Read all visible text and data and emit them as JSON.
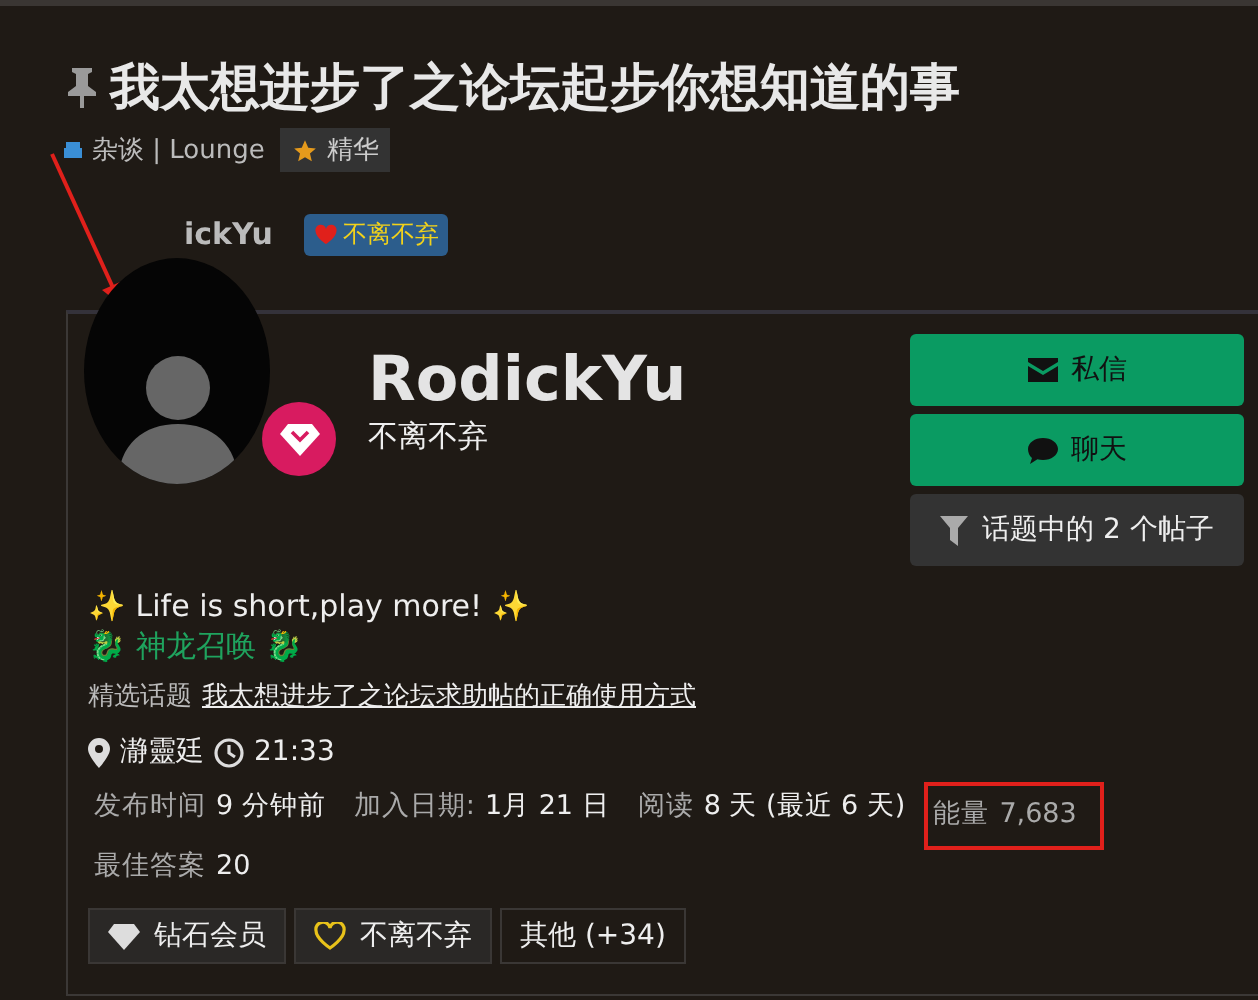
{
  "topic": {
    "title": "我太想进步了之论坛起步你想知道的事",
    "category": "杂谈 | Lounge",
    "tag": "精华"
  },
  "poster": {
    "name": "ickYu",
    "badge": "不离不弃"
  },
  "user_card": {
    "name": "RodickYu",
    "title": "不离不弃",
    "actions": [
      {
        "kind": "mail",
        "label": "私信"
      },
      {
        "kind": "chat",
        "label": "聊天"
      },
      {
        "kind": "filter",
        "label": "话题中的 2 个帖子"
      }
    ],
    "bio": [
      "✨ Life is short,play more! ✨",
      "🐉 神龙召唤 🐉"
    ],
    "featured": {
      "label": "精选话题",
      "link": "我太想进步了之论坛求助帖的正确使用方式"
    },
    "location": "瀞靈廷",
    "local_time": "21:33",
    "stats": [
      {
        "label": "发布时间",
        "value": "9 分钟前"
      },
      {
        "label": "加入日期:",
        "value": "1月 21 日"
      },
      {
        "label": "阅读",
        "value": "8 天 (最近 6 天)"
      },
      {
        "label": "能量",
        "value": "7,683",
        "highlighted": true
      },
      {
        "label": "最佳答案",
        "value": "20"
      }
    ],
    "badges": [
      {
        "kind": "diamond",
        "label": "钻石会员"
      },
      {
        "kind": "heart",
        "label": "不离不弃"
      },
      {
        "kind": "more",
        "label": "其他 (+34)"
      }
    ]
  }
}
